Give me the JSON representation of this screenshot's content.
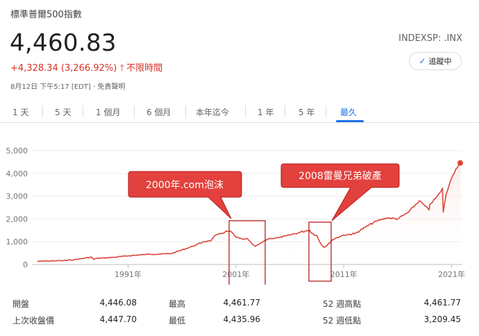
{
  "header": {
    "title": "標準普爾500指數",
    "price": "4,460.83",
    "change": "+4,328.34 (3,266.92%)",
    "change_period": "不限時間",
    "timestamp": "8月12日 下午5:17 [EDT] · 免責聲明",
    "ticker": "INDEXSP: .INX",
    "follow_label": "追蹤中"
  },
  "tabs": [
    "1 天",
    "5 天",
    "1 個月",
    "6 個月",
    "本年迄今",
    "1 年",
    "5 年",
    "最久"
  ],
  "active_tab": "最久",
  "colors": {
    "line": "#db4437",
    "accent": "#1a73e8",
    "negative": "#d93025",
    "annotation": "#b71c1c"
  },
  "chart_data": {
    "type": "area",
    "y_ticks": [
      "0",
      "1,000",
      "2,000",
      "3,000",
      "4,000",
      "5,000"
    ],
    "ylim": [
      0,
      5000
    ],
    "x_ticks": [
      "1991年",
      "2001年",
      "2011年",
      "2021年"
    ],
    "xlim": [
      1982.6,
      2021.8
    ],
    "series": [
      {
        "x": [
          1982.6,
          1984,
          1985,
          1986,
          1987,
          1987.6,
          1987.8,
          1988,
          1990,
          1991,
          1992,
          1993,
          1994,
          1995,
          1996,
          1997,
          1998,
          1998.7,
          1999,
          1999.5,
          2000,
          2000.2,
          2000.6,
          2001,
          2001.7,
          2002,
          2002.5,
          2002.8,
          2003,
          2004,
          2005,
          2006,
          2007,
          2007.8,
          2008,
          2008.5,
          2008.75,
          2009,
          2009.2,
          2010,
          2011,
          2012,
          2013,
          2014,
          2015,
          2016,
          2017,
          2018,
          2018.9,
          2019,
          2019.5,
          2020,
          2020.15,
          2020.22,
          2020.5,
          2021,
          2021.4,
          2021.8
        ],
        "values": [
          140,
          160,
          170,
          210,
          280,
          330,
          230,
          260,
          330,
          380,
          420,
          450,
          460,
          480,
          640,
          800,
          1000,
          1050,
          1250,
          1350,
          1430,
          1460,
          1420,
          1200,
          1100,
          1150,
          900,
          800,
          850,
          1130,
          1180,
          1300,
          1420,
          1520,
          1380,
          1280,
          1000,
          820,
          750,
          1100,
          1300,
          1350,
          1640,
          1900,
          2050,
          2000,
          2300,
          2800,
          2400,
          2650,
          2900,
          3200,
          3350,
          2300,
          3100,
          3800,
          4200,
          4460
        ]
      }
    ],
    "grid": true
  },
  "annotations": [
    {
      "label": "2000年.com泡沫"
    },
    {
      "label": "2008雷曼兄弟破產"
    }
  ],
  "stats": {
    "open_label": "開盤",
    "open": "4,446.08",
    "high_label": "最高",
    "high": "4,461.77",
    "wk52_high_label": "52 週高點",
    "wk52_high": "4,461.77",
    "prev_close_label": "上次收盤價",
    "prev_close": "4,447.70",
    "low_label": "最低",
    "low": "4,435.96",
    "wk52_low_label": "52 週低點",
    "wk52_low": "3,209.45"
  }
}
